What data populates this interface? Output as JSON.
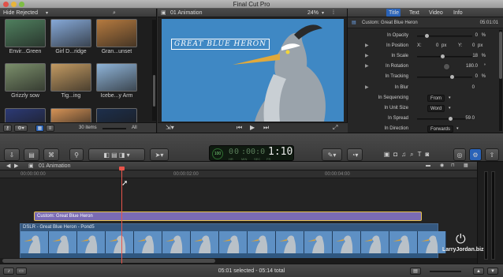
{
  "window": {
    "title": "Final Cut Pro"
  },
  "browser": {
    "filter_label": "Hide Rejected",
    "clips": [
      {
        "label": "Envir...Green",
        "color": "#4f7f5e"
      },
      {
        "label": "Girl D...ridge",
        "color": "#86a9d8"
      },
      {
        "label": "Gran...unset",
        "color": "#b57a3f"
      },
      {
        "label": "Grizzly sow",
        "color": "#7b8f6b"
      },
      {
        "label": "Tig...ing",
        "color": "#c29a62"
      },
      {
        "label": "Icebe...y Arm",
        "color": "#8fb4d8"
      },
      {
        "label": "",
        "color": "#2c3a76"
      },
      {
        "label": "",
        "color": "#d69356"
      },
      {
        "label": "",
        "color": "#1d2f4c"
      }
    ],
    "item_count": "30 items",
    "zoom_label": "All"
  },
  "viewer": {
    "title": "01 Animation",
    "zoom": "24%",
    "overlay_text": "Great Blue Heron"
  },
  "inspector": {
    "tabs": [
      "Title",
      "Text",
      "Video",
      "Info"
    ],
    "active_tab": "Title",
    "clip_name": "Custom: Great Blue Heron",
    "clip_time": "05:01:01",
    "rows": [
      {
        "label": "In Opacity",
        "value": "0",
        "unit": "%"
      },
      {
        "label": "In Position",
        "x_label": "X:",
        "x": "0",
        "x_unit": "px",
        "y_label": "Y:",
        "y": "0",
        "y_unit": "px"
      },
      {
        "label": "In Scale",
        "value": "18",
        "unit": "%"
      },
      {
        "label": "In Rotation",
        "value": "180.0",
        "unit": "°"
      },
      {
        "label": "In Tracking",
        "value": "0",
        "unit": "%"
      },
      {
        "label": "In Blur",
        "value": "0",
        "unit": ""
      },
      {
        "label": "In Sequencing",
        "value": "From"
      },
      {
        "label": "In Unit Size",
        "value": "Word"
      },
      {
        "label": "In Spread",
        "value": "59.0"
      },
      {
        "label": "In Direction",
        "value": "Forwards"
      }
    ]
  },
  "toolbar": {
    "timecode": "00:00:01:10",
    "timecode_hr": "00",
    "timecode_main": "1:10",
    "timecode_units": [
      "HR",
      "MIN",
      "SEC",
      "FR"
    ],
    "sync_badge": "100"
  },
  "timeline": {
    "project_name": "01 Animation",
    "ruler_marks": [
      "00:00:00:00",
      "00:00:02:00",
      "00:00:04:00"
    ],
    "title_clip": "Custom: Great Blue Heron",
    "video_clip": "DSLR - Great Blue Heron - Pond5"
  },
  "status": {
    "selection": "05:01 selected - 05:14 total"
  },
  "watermark": "LarryJordan.biz",
  "colors": {
    "accent_blue": "#3a7bd5",
    "playhead": "#e8544a",
    "title_clip": "#7a6bb4",
    "video_clip": "#2b4e74"
  }
}
